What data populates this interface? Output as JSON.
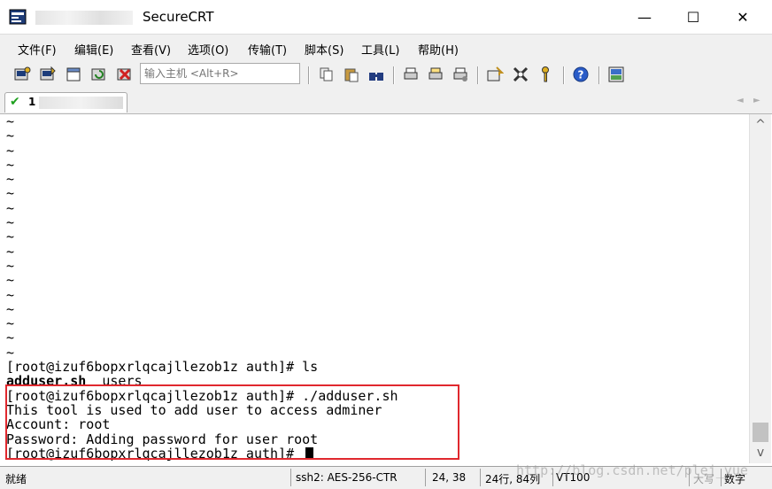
{
  "window": {
    "title": "SecureCRT",
    "minimize_glyph": "—",
    "maximize_glyph": "☐",
    "close_glyph": "✕"
  },
  "menu": [
    "文件(F)",
    "编辑(E)",
    "查看(V)",
    "选项(O)",
    "传输(T)",
    "脚本(S)",
    "工具(L)",
    "帮助(H)"
  ],
  "toolbar": {
    "host_placeholder": "输入主机 <Alt+R>",
    "icons": [
      "connect-icon",
      "quick-connect-icon",
      "connect-in-tab-icon",
      "reconnect-icon",
      "disconnect-icon",
      "copy-icon",
      "paste-icon",
      "find-icon",
      "print-icon",
      "print-selection-icon",
      "print-setup-icon",
      "session-options-icon",
      "global-options-icon",
      "key-icon",
      "help-icon",
      "sftp-icon"
    ]
  },
  "tab": {
    "label": "1",
    "status_icon": "check-icon"
  },
  "terminal": {
    "tilde_lines": [
      "~",
      "~",
      "~",
      "~",
      "~",
      "~",
      "~",
      "~",
      "~",
      "~",
      "~",
      "~",
      "~",
      "~",
      "~",
      "~",
      "~"
    ],
    "cmd_ls": "[root@izuf6bopxrlqcajllezob1z auth]# ls",
    "ls_file1": "adduser.sh",
    "ls_file2": "  users",
    "cmd_adduser": "[root@izuf6bopxrlqcajllezob1z auth]# ./adduser.sh",
    "output1": "This tool is used to add user to access adminer",
    "output2": "Account: root",
    "output3": "Password: Adding password for user root",
    "prompt_final": "[root@izuf6bopxrlqcajllezob1z auth]# "
  },
  "scrollbar": {
    "up_glyph": "^",
    "down_glyph": "v"
  },
  "status": {
    "ready": "就绪",
    "cipher": "ssh2: AES-256-CTR",
    "cursor_pos": "24,  38",
    "dims": "24行, 84列",
    "emulation": "VT100",
    "caps": "大写",
    "num": "数字"
  },
  "watermark": "http://blog.csdn.net/plej_yue",
  "colors": {
    "highlight_border": "#e0282e",
    "tab_check": "#1ea01e"
  }
}
